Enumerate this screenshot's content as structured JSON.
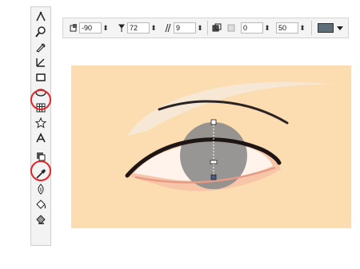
{
  "toolbox": {
    "tools": [
      {
        "name": "freehand-tool"
      },
      {
        "name": "zoom-tool"
      },
      {
        "name": "pen-tool"
      },
      {
        "name": "dimension-tool"
      },
      {
        "name": "rectangle-tool"
      },
      {
        "name": "ellipse-tool",
        "highlighted": true
      },
      {
        "name": "table-tool"
      },
      {
        "name": "star-tool"
      },
      {
        "name": "text-tool"
      },
      {
        "name": "transparency-tool",
        "highlighted": true
      },
      {
        "name": "eyedropper-tool"
      },
      {
        "name": "outline-pen-tool"
      },
      {
        "name": "fill-tool"
      },
      {
        "name": "interactive-fill-tool"
      }
    ]
  },
  "property_bar": {
    "angle_value": "-90",
    "angle2_value": "72",
    "edge_pad_value": "9",
    "start_value": "0",
    "end_value": "50",
    "color": "#5f6f7a"
  },
  "colors": {
    "canvas_background": "#fcdcb1",
    "highlight_ring": "#e0262b",
    "iris_gray": "#8c8c8c"
  }
}
